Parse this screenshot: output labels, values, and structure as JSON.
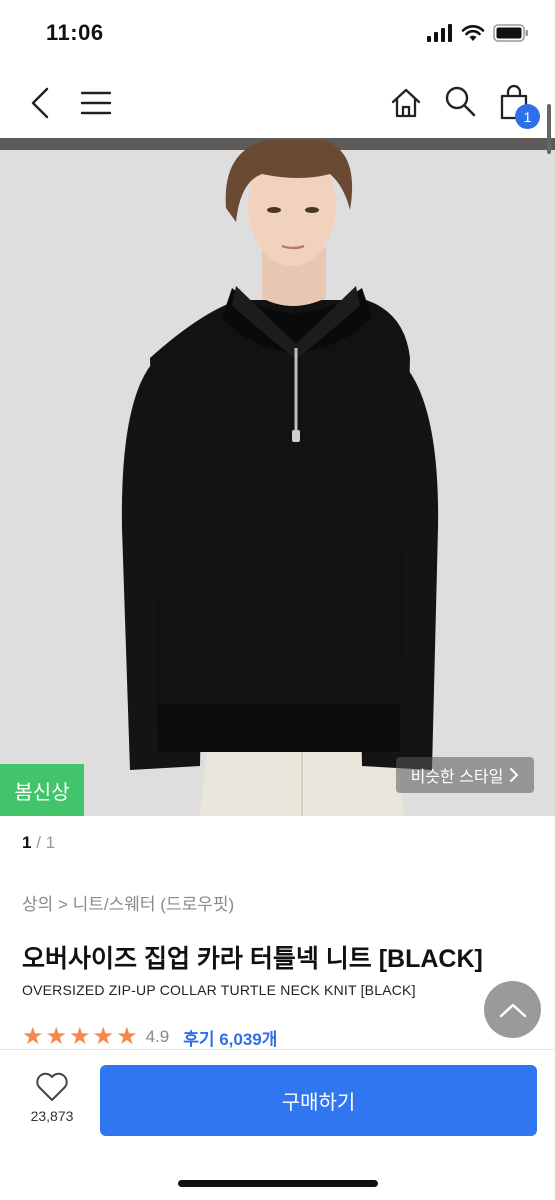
{
  "status": {
    "time": "11:06",
    "icons": [
      "signal-icon",
      "wifi-icon",
      "battery-icon"
    ]
  },
  "nav": {
    "icons": [
      "back-arrow-icon",
      "hamburger-menu-icon",
      "home-icon",
      "search-icon",
      "shopping-bag-icon"
    ],
    "cart_count": "1"
  },
  "hero": {
    "badge": "봄신상",
    "similar_style": "비슷한 스타일",
    "page_current": "1",
    "page_total": " / 1"
  },
  "product": {
    "breadcrumb": "상의 > 니트/스웨터 (드로우핏)",
    "title_kr": "오버사이즈 집업 카라 터틀넥 니트 [BLACK]",
    "title_en": "OVERSIZED ZIP-UP COLLAR TURTLE NECK KNIT [BLACK]",
    "rating": "4.9",
    "stars": 5,
    "reviews": "후기 6,039개"
  },
  "bottom": {
    "like_count": "23,873",
    "buy_label": "구매하기"
  },
  "colors": {
    "accent": "#2f76f0",
    "badge_green": "#41c46a",
    "star": "#f5894d"
  }
}
